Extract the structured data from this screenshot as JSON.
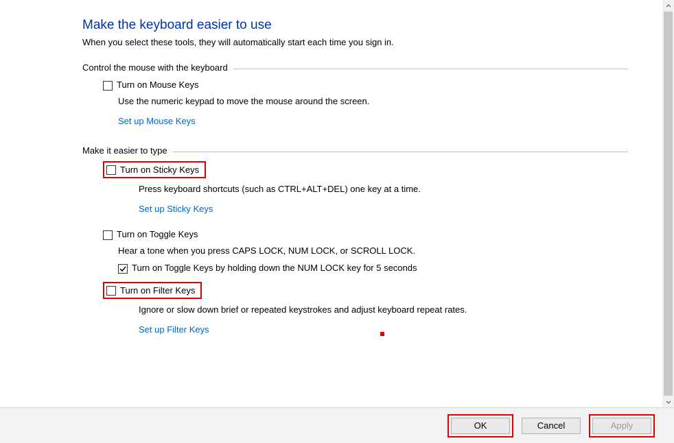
{
  "title": "Make the keyboard easier to use",
  "subtitle": "When you select these tools, they will automatically start each time you sign in.",
  "group1": {
    "caption": "Control the mouse with the keyboard",
    "mouseKeys": {
      "label": "Turn on Mouse Keys",
      "desc": "Use the numeric keypad to move the mouse around the screen.",
      "link": "Set up Mouse Keys"
    }
  },
  "group2": {
    "caption": "Make it easier to type",
    "stickyKeys": {
      "label": "Turn on Sticky Keys",
      "desc": "Press keyboard shortcuts (such as CTRL+ALT+DEL) one key at a time.",
      "link": "Set up Sticky Keys"
    },
    "toggleKeys": {
      "label": "Turn on Toggle Keys",
      "desc": "Hear a tone when you press CAPS LOCK, NUM LOCK, or SCROLL LOCK.",
      "holdLabel": "Turn on Toggle Keys by holding down the NUM LOCK key for 5 seconds"
    },
    "filterKeys": {
      "label": "Turn on Filter Keys",
      "desc": "Ignore or slow down brief or repeated keystrokes and adjust keyboard repeat rates.",
      "link": "Set up Filter Keys"
    }
  },
  "footer": {
    "ok": "OK",
    "cancel": "Cancel",
    "apply": "Apply"
  }
}
